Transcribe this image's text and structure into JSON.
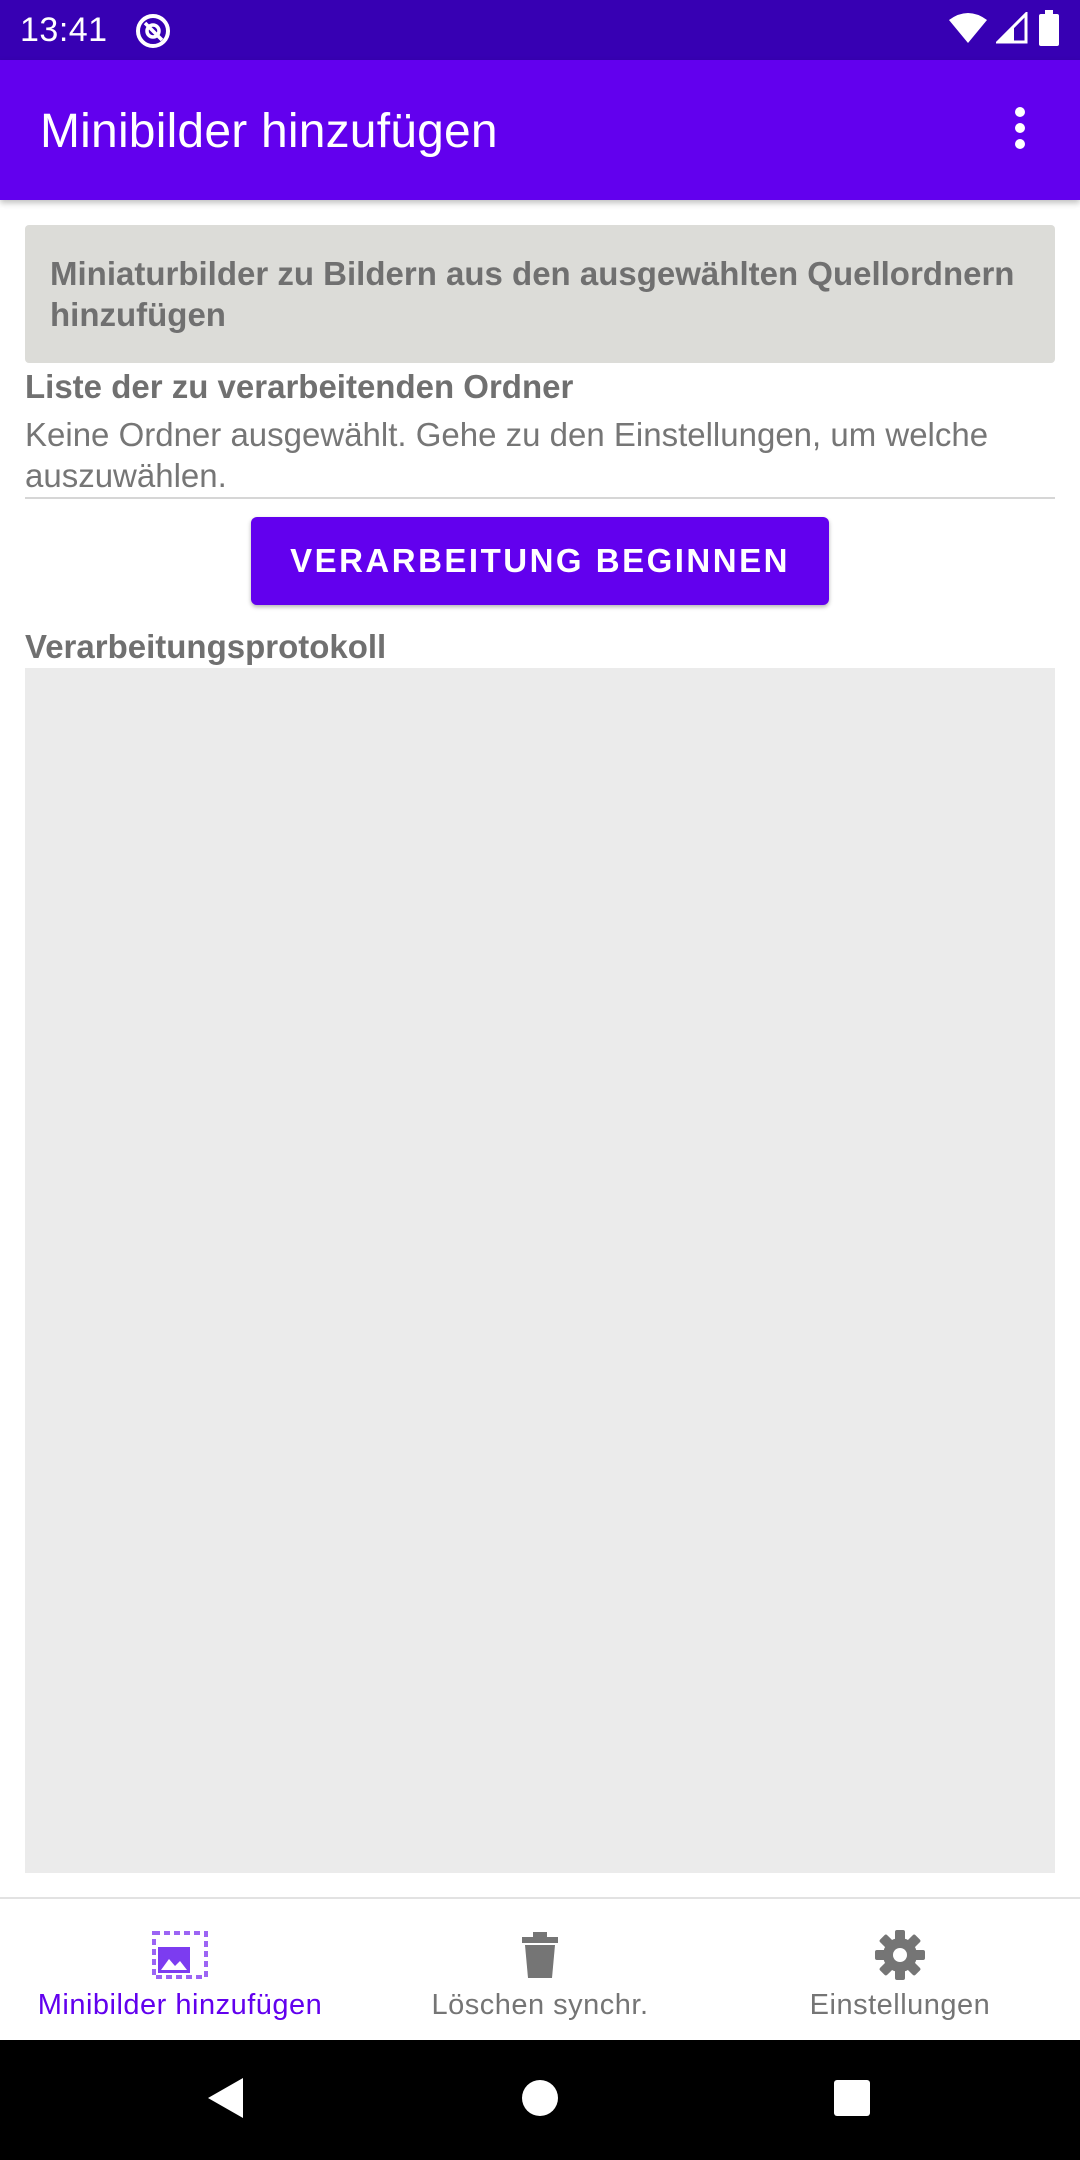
{
  "status_bar": {
    "time": "13:41",
    "app_icon": "at-sign-icon",
    "icons": [
      "wifi-icon",
      "cell-signal-icon",
      "battery-icon"
    ]
  },
  "app_bar": {
    "title": "Minibilder hinzufügen",
    "menu_icon": "more-vert-icon"
  },
  "info_box": {
    "text": "Miniaturbilder zu Bildern aus den ausgewählten Quellordnern hinzufügen"
  },
  "folders": {
    "heading": "Liste der zu verarbeitenden Ordner",
    "text": "Keine Ordner ausgewählt. Gehe zu den Einstellungen, um welche auszuwählen."
  },
  "start_button": {
    "label": "VERARBEITUNG BEGINNEN"
  },
  "log": {
    "heading": "Verarbeitungsprotokoll"
  },
  "bottom_nav": {
    "items": [
      {
        "label": "Minibilder hinzufügen",
        "icon": "add-thumbnail-icon",
        "active": true
      },
      {
        "label": "Löschen synchr.",
        "icon": "delete-icon",
        "active": false
      },
      {
        "label": "Einstellungen",
        "icon": "settings-icon",
        "active": false
      }
    ]
  },
  "colors": {
    "primary": "#6200ee",
    "primary_dark": "#3700b3",
    "active_nav": "#6200ee",
    "inactive_nav": "#757575"
  },
  "system_nav": {
    "icons": [
      "back-icon",
      "home-icon",
      "recents-icon"
    ]
  }
}
